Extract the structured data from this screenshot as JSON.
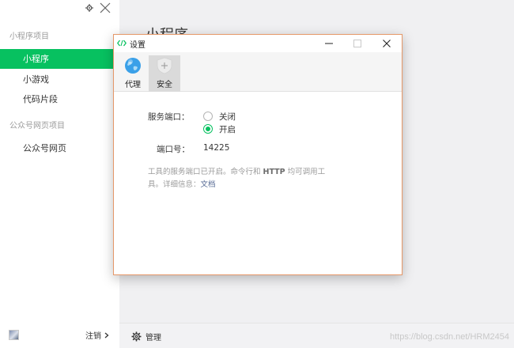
{
  "sidebar": {
    "sections": [
      {
        "title": "小程序项目",
        "items": [
          "小程序",
          "小游戏",
          "代码片段"
        ]
      },
      {
        "title": "公众号网页项目",
        "items": [
          "公众号网页"
        ]
      }
    ],
    "active_item": "小程序",
    "logout_label": "注销"
  },
  "main": {
    "title": "小程序",
    "manage_label": "管理",
    "watermark": "https://blog.csdn.net/HRM2454"
  },
  "dialog": {
    "title": "设置",
    "tabs": [
      {
        "label": "代理",
        "icon": "globe-icon"
      },
      {
        "label": "安全",
        "icon": "shield-icon",
        "selected": true
      }
    ],
    "service_port_label": "服务端口：",
    "options": [
      "关闭",
      "开启"
    ],
    "selected_option": "开启",
    "port_label": "端口号：",
    "port_value": "14225",
    "hint_part1": "工具的服务端口已开启。命令行和 ",
    "hint_bold": "HTTP",
    "hint_part2": " 均可调用工具。详细信息：",
    "hint_link": "文档"
  },
  "colors": {
    "accent": "#07c160",
    "dialog_border": "#e59869",
    "link": "#576b95"
  }
}
